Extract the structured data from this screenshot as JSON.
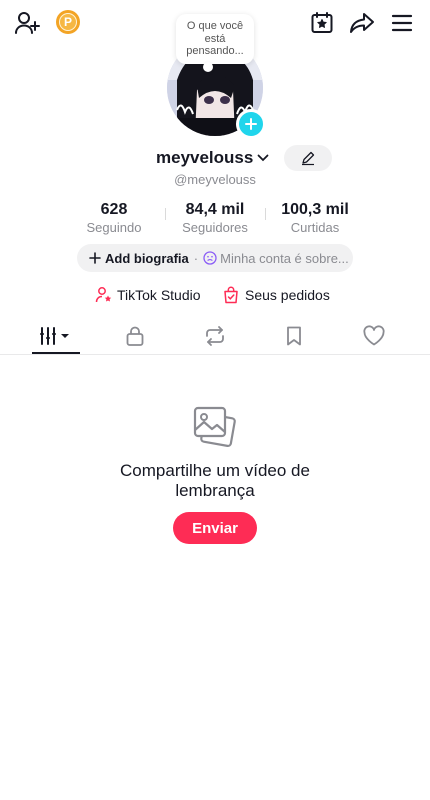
{
  "top_bar": {
    "add_user_icon": "add-user-icon",
    "coin_icon": "coin-icon",
    "coin_letter": "P",
    "calendar_icon": "calendar-star-icon",
    "share_icon": "share-icon",
    "menu_icon": "menu-icon"
  },
  "profile": {
    "thought_bubble": "O que você está pensando...",
    "username": "meyvelouss",
    "handle": "@meyvelouss",
    "stats": {
      "following_value": "628",
      "following_label": "Seguindo",
      "followers_value": "84,4 mil",
      "followers_label": "Seguidores",
      "likes_value": "100,3 mil",
      "likes_label": "Curtidas"
    },
    "bio_add_label": "Add biografia",
    "bio_separator": "·",
    "bio_mood_label": "Minha conta é sobre..."
  },
  "links": {
    "studio_label": "TikTok Studio",
    "orders_label": "Seus pedidos"
  },
  "tabs": [
    {
      "id": "videos",
      "icon": "grid-filter-icon",
      "active": true
    },
    {
      "id": "private",
      "icon": "lock-icon"
    },
    {
      "id": "reposts",
      "icon": "repost-icon"
    },
    {
      "id": "saved",
      "icon": "bookmark-icon"
    },
    {
      "id": "liked",
      "icon": "heart-icon"
    }
  ],
  "empty_state": {
    "title": "Compartilhe um vídeo de lembrança",
    "button_label": "Enviar"
  },
  "colors": {
    "accent": "#fe2c55",
    "avatar_add": "#20d5ec",
    "coin": "#f3a425"
  }
}
